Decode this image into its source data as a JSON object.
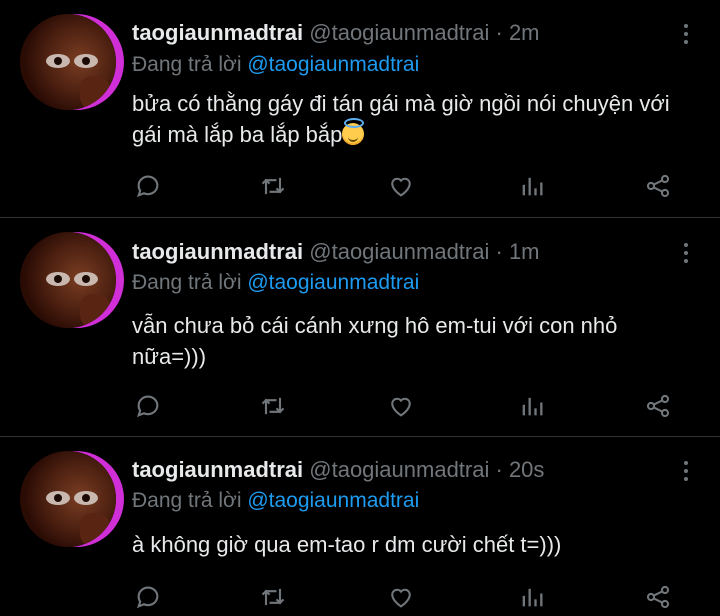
{
  "tweets": [
    {
      "username": "taogiaunmadtrai",
      "handle": "@taogiaunmadtrai",
      "time": "· 2m",
      "reply_prefix": "Đang trả lời ",
      "reply_to": "@taogiaunmadtrai",
      "text": "bửa có thằng gáy đi tán gái mà giờ ngồi nói chuyện với gái mà lắp ba lắp bắp",
      "emoji": "smiling-face-with-halo"
    },
    {
      "username": "taogiaunmadtrai",
      "handle": "@taogiaunmadtrai",
      "time": "· 1m",
      "reply_prefix": "Đang trả lời ",
      "reply_to": "@taogiaunmadtrai",
      "text": "vẫn chưa bỏ cái cánh xưng hô em-tui với con nhỏ nữa=)))"
    },
    {
      "username": "taogiaunmadtrai",
      "handle": "@taogiaunmadtrai",
      "time": "· 20s",
      "reply_prefix": "Đang trả lời ",
      "reply_to": "@taogiaunmadtrai",
      "text": "à không giờ qua em-tao r dm cười chết t=)))"
    }
  ],
  "colors": {
    "background": "#000000",
    "text": "#e7e9ea",
    "muted": "#71767b",
    "link": "#1d9bf0",
    "divider": "#2f3336",
    "avatar_ring": "#d02fd8"
  },
  "icons": [
    "reply-icon",
    "retweet-icon",
    "like-icon",
    "analytics-icon",
    "share-icon"
  ]
}
